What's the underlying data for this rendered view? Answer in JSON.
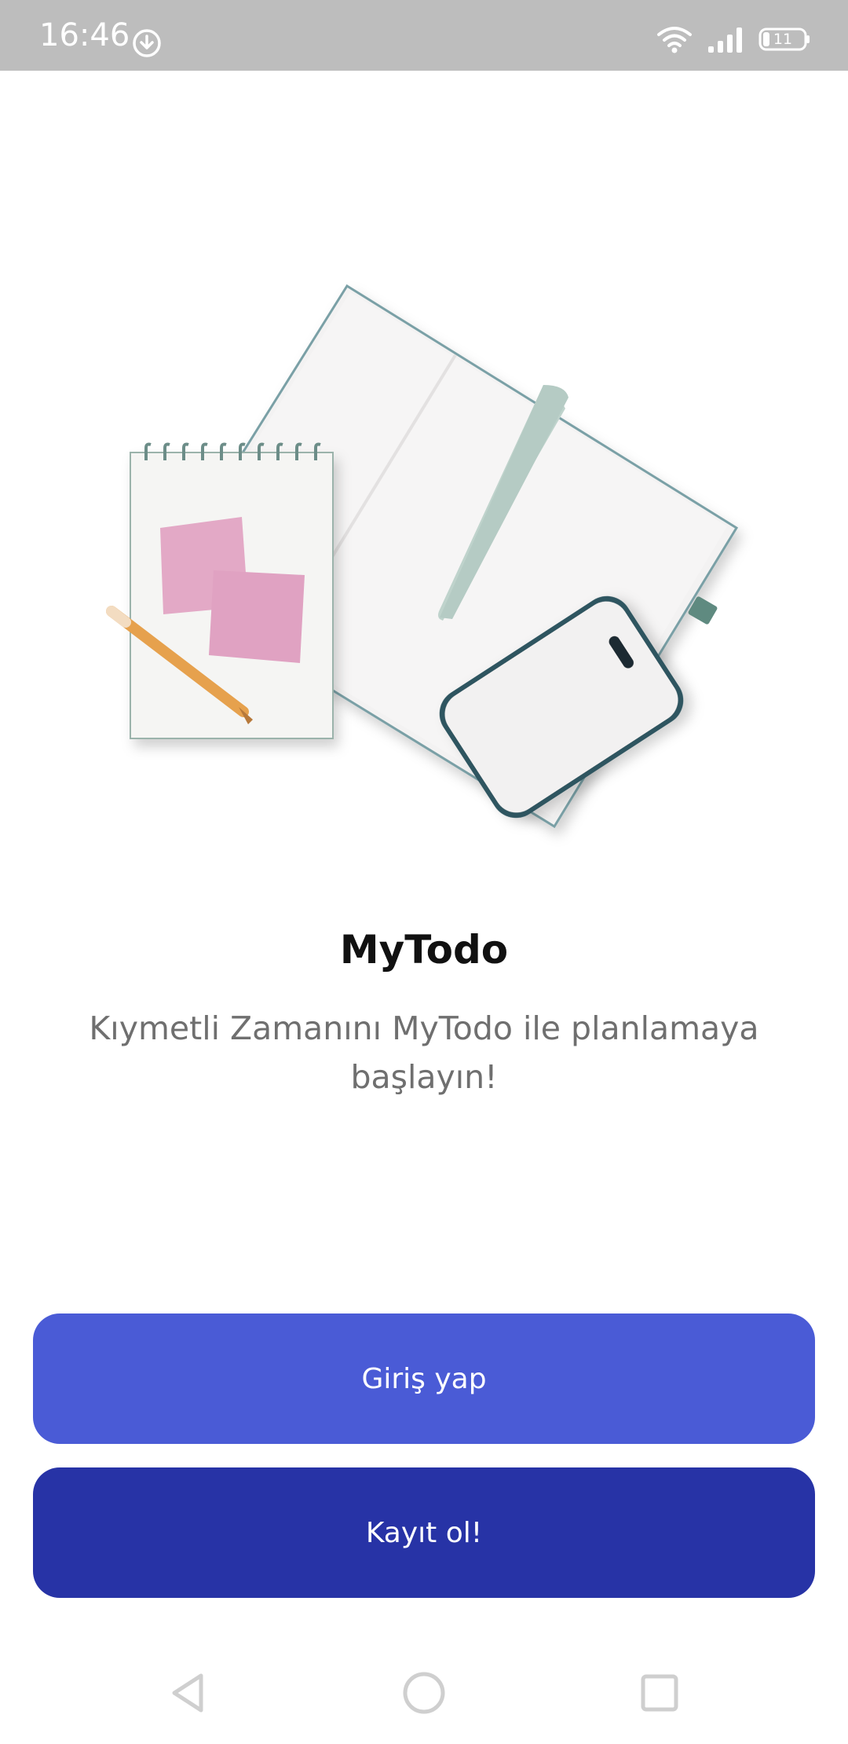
{
  "status_bar": {
    "time": "16:46",
    "battery_level": "11",
    "icons": [
      "download-icon",
      "wifi-icon",
      "signal-icon",
      "battery-icon"
    ]
  },
  "illustration": {
    "name": "notebook-phone-illustration"
  },
  "main": {
    "title": "MyTodo",
    "subtitle": "Kıymetli Zamanını MyTodo ile planlamaya başlayın!"
  },
  "buttons": {
    "login_label": "Giriş yap",
    "register_label": "Kayıt ol!"
  },
  "nav_bar": {
    "icons": [
      "back-icon",
      "home-icon",
      "recents-icon"
    ]
  },
  "colors": {
    "status_bar_bg": "#bdbdbd",
    "login_button": "#4a5bd6",
    "register_button": "#2733a6",
    "title_text": "#111111",
    "subtitle_text": "#6f6f6f"
  }
}
